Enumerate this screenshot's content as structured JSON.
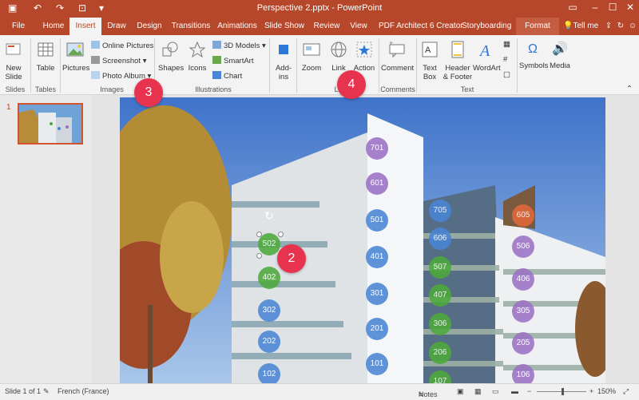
{
  "window": {
    "title": "Perspective 2.pptx - PowerPoint",
    "controls": [
      "minimize-icon",
      "maximize-icon",
      "close-icon",
      "ribbon-options-icon"
    ]
  },
  "tabs": [
    "File",
    "Home",
    "Insert",
    "Draw",
    "Design",
    "Transitions",
    "Animations",
    "Slide Show",
    "Review",
    "View",
    "PDF Architect 6 Creator",
    "Storyboarding",
    "Format"
  ],
  "tell_me": "Tell me",
  "ribbon": {
    "new_slide": "New\nSlide",
    "table": "Table",
    "pictures": "Pictures",
    "online_pictures": "Online Pictures",
    "screenshot": "Screenshot",
    "photo_album": "Photo Album",
    "shapes": "Shapes",
    "icons": "Icons",
    "models_3d": "3D Models",
    "smartart": "SmartArt",
    "chart": "Chart",
    "addins": "Add-\nins",
    "zoom": "Zoom",
    "link": "Link",
    "action": "Action",
    "comment": "Comment",
    "text_box": "Text\nBox",
    "header_footer": "Header\n& Footer",
    "wordart": "WordArt",
    "symbols": "Symbols",
    "media": "Media",
    "groups": {
      "slides": "Slides",
      "tables": "Tables",
      "images": "Images",
      "illustrations": "Illustrations",
      "links": "Li",
      "comments": "Comments",
      "text": "Text"
    }
  },
  "thumbnails": [
    {
      "number": "1"
    }
  ],
  "units": {
    "left_column": [
      "701",
      "601",
      "501",
      "401",
      "301",
      "201",
      "101"
    ],
    "left_wing": [
      "502",
      "402",
      "302",
      "202",
      "102"
    ],
    "middle_column": [
      "705",
      "606",
      "507",
      "407",
      "306",
      "206",
      "107"
    ],
    "right_column": [
      "605",
      "506",
      "406",
      "305",
      "205",
      "106"
    ]
  },
  "markers": [
    "2",
    "3",
    "4"
  ],
  "status": {
    "slide": "Slide 1 of 1",
    "language": "French (France)",
    "notes": "Notes",
    "zoom": "150%"
  },
  "colors": {
    "accent": "#b7472a",
    "marker": "#e8334f",
    "unit_green": "#4eaa3c",
    "unit_blue": "#4a86d6",
    "unit_purple": "#9b72c6",
    "unit_orange": "#e2673a"
  }
}
